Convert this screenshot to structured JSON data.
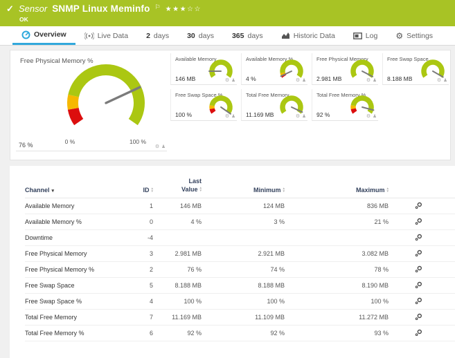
{
  "colors": {
    "header_green": "#a8c325",
    "gauge_green": "#abc712",
    "warn_yellow": "#f6b800",
    "error_red": "#dc0e0e",
    "accent_blue": "#31a8dc",
    "table_header_text": "#33415c"
  },
  "icons": {
    "check": "✓",
    "flag": "⚐",
    "gear": "⚙",
    "pin": "♟",
    "sort_up": "▴",
    "sort_down": "▾",
    "sorted_desc": "▾"
  },
  "header": {
    "type_label": "Sensor",
    "title": "SNMP Linux Meminfo",
    "status": "OK",
    "stars_filled": "★★★",
    "stars_empty": "☆☆"
  },
  "tabs": {
    "overview": "Overview",
    "live_data": "Live Data",
    "d2_num": "2",
    "d2_label": "days",
    "d30_num": "30",
    "d30_label": "days",
    "d365_num": "365",
    "d365_label": "days",
    "historic": "Historic Data",
    "log": "Log",
    "settings": "Settings"
  },
  "chart_data": {
    "type": "gauge",
    "main_gauge": {
      "title": "Free Physical Memory %",
      "value_label": "76 %",
      "scale_min": "0 %",
      "scale_max": "100 %",
      "value_pct": 76,
      "needle_pct": 76,
      "axis_range": [
        0,
        100
      ],
      "segments": [
        {
          "from": 0,
          "to": 10,
          "color": "#dc0e0e"
        },
        {
          "from": 10,
          "to": 19,
          "color": "#f6b800"
        },
        {
          "from": 19,
          "to": 100,
          "color": "#abc712"
        }
      ]
    },
    "small_gauges": [
      {
        "title": "Available Memory",
        "value_label": "146 MB",
        "needle_pct": 14,
        "segments": [
          {
            "from": 0,
            "to": 100,
            "color": "#abc712"
          }
        ]
      },
      {
        "title": "Available Memory %",
        "value_label": "4 %",
        "needle_pct": 4,
        "segments": [
          {
            "from": 0,
            "to": 5,
            "color": "#dc0e0e"
          },
          {
            "from": 5,
            "to": 10,
            "color": "#f6b800"
          },
          {
            "from": 10,
            "to": 100,
            "color": "#abc712"
          }
        ]
      },
      {
        "title": "Free Physical Memory",
        "value_label": "2.981 MB",
        "needle_pct": 97,
        "segments": [
          {
            "from": 0,
            "to": 100,
            "color": "#abc712"
          }
        ]
      },
      {
        "title": "Free Swap Space",
        "value_label": "8.188 MB",
        "needle_pct": 98,
        "segments": [
          {
            "from": 0,
            "to": 100,
            "color": "#abc712"
          }
        ]
      },
      {
        "title": "Free Swap Space %",
        "value_label": "100 %",
        "needle_pct": 100,
        "segments": [
          {
            "from": 0,
            "to": 10,
            "color": "#dc0e0e"
          },
          {
            "from": 10,
            "to": 18,
            "color": "#f6b800"
          },
          {
            "from": 18,
            "to": 100,
            "color": "#abc712"
          }
        ]
      },
      {
        "title": "Total Free Memory",
        "value_label": "11.169 MB",
        "needle_pct": 96,
        "segments": [
          {
            "from": 0,
            "to": 100,
            "color": "#abc712"
          }
        ]
      },
      {
        "title": "Total Free Memory %",
        "value_label": "92 %",
        "needle_pct": 92,
        "segments": [
          {
            "from": 0,
            "to": 10,
            "color": "#dc0e0e"
          },
          {
            "from": 10,
            "to": 18,
            "color": "#f6b800"
          },
          {
            "from": 18,
            "to": 100,
            "color": "#abc712"
          }
        ]
      }
    ]
  },
  "table": {
    "headers": {
      "channel": "Channel",
      "id": "ID",
      "last_line1": "Last",
      "last_line2": "Value",
      "minimum": "Minimum",
      "maximum": "Maximum"
    },
    "rows": [
      {
        "name": "Available Memory",
        "id": "1",
        "last": "146 MB",
        "min": "124 MB",
        "max": "836 MB"
      },
      {
        "name": "Available Memory %",
        "id": "0",
        "last": "4 %",
        "min": "3 %",
        "max": "21 %"
      },
      {
        "name": "Downtime",
        "id": "-4",
        "last": "",
        "min": "",
        "max": ""
      },
      {
        "name": "Free Physical Memory",
        "id": "3",
        "last": "2.981 MB",
        "min": "2.921 MB",
        "max": "3.082 MB"
      },
      {
        "name": "Free Physical Memory %",
        "id": "2",
        "last": "76 %",
        "min": "74 %",
        "max": "78 %"
      },
      {
        "name": "Free Swap Space",
        "id": "5",
        "last": "8.188 MB",
        "min": "8.188 MB",
        "max": "8.190 MB"
      },
      {
        "name": "Free Swap Space %",
        "id": "4",
        "last": "100 %",
        "min": "100 %",
        "max": "100 %"
      },
      {
        "name": "Total Free Memory",
        "id": "7",
        "last": "11.169 MB",
        "min": "11.109 MB",
        "max": "11.272 MB"
      },
      {
        "name": "Total Free Memory %",
        "id": "6",
        "last": "92 %",
        "min": "92 %",
        "max": "93 %"
      }
    ]
  }
}
